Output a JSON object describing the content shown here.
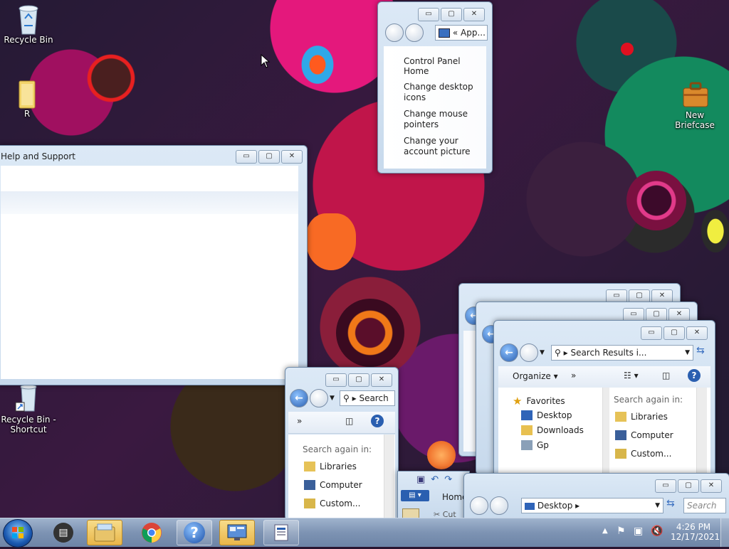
{
  "desktop": {
    "icons": [
      {
        "label": "Recycle Bin",
        "icon": "recycle-bin-icon"
      },
      {
        "label": "R",
        "icon": "folder-icon"
      },
      {
        "label": "New Briefcase",
        "icon": "briefcase-icon"
      },
      {
        "label": "Recycle Bin - Shortcut",
        "icon": "recycle-bin-shortcut-icon"
      }
    ]
  },
  "windows": {
    "help": {
      "title": "Help and Support"
    },
    "personalize": {
      "address": "App...",
      "address_prefix": "«",
      "links": [
        "Control Panel Home",
        "Change desktop icons",
        "Change mouse pointers",
        "Change your account picture"
      ]
    },
    "search_small": {
      "search_label": "Search",
      "more": "»",
      "search_again": "Search again in:",
      "items": [
        "Libraries",
        "Computer",
        "Custom..."
      ]
    },
    "search_results": {
      "address": "Search Results i...",
      "organize": "Organize",
      "more": "»",
      "nav": [
        "Favorites",
        "Desktop",
        "Downloads",
        "Gp"
      ],
      "search_again": "Search again in:",
      "items": [
        "Libraries",
        "Computer",
        "Custom..."
      ]
    },
    "wordpad": {
      "tab": "Home",
      "cut": "Cut"
    },
    "desktop_window": {
      "address": "Desktop",
      "search_placeholder": "Search"
    }
  },
  "caption_buttons": {
    "minimize": "▭",
    "maximize": "▢",
    "close": "✕"
  },
  "taskbar": {
    "start": "start-orb-icon",
    "apps": [
      "chat-icon",
      "explorer-icon",
      "chrome-icon",
      "help-icon",
      "control-panel-icon",
      "wordpad-icon"
    ],
    "clock_time": "4:26 PM",
    "clock_date": "12/17/2021"
  }
}
